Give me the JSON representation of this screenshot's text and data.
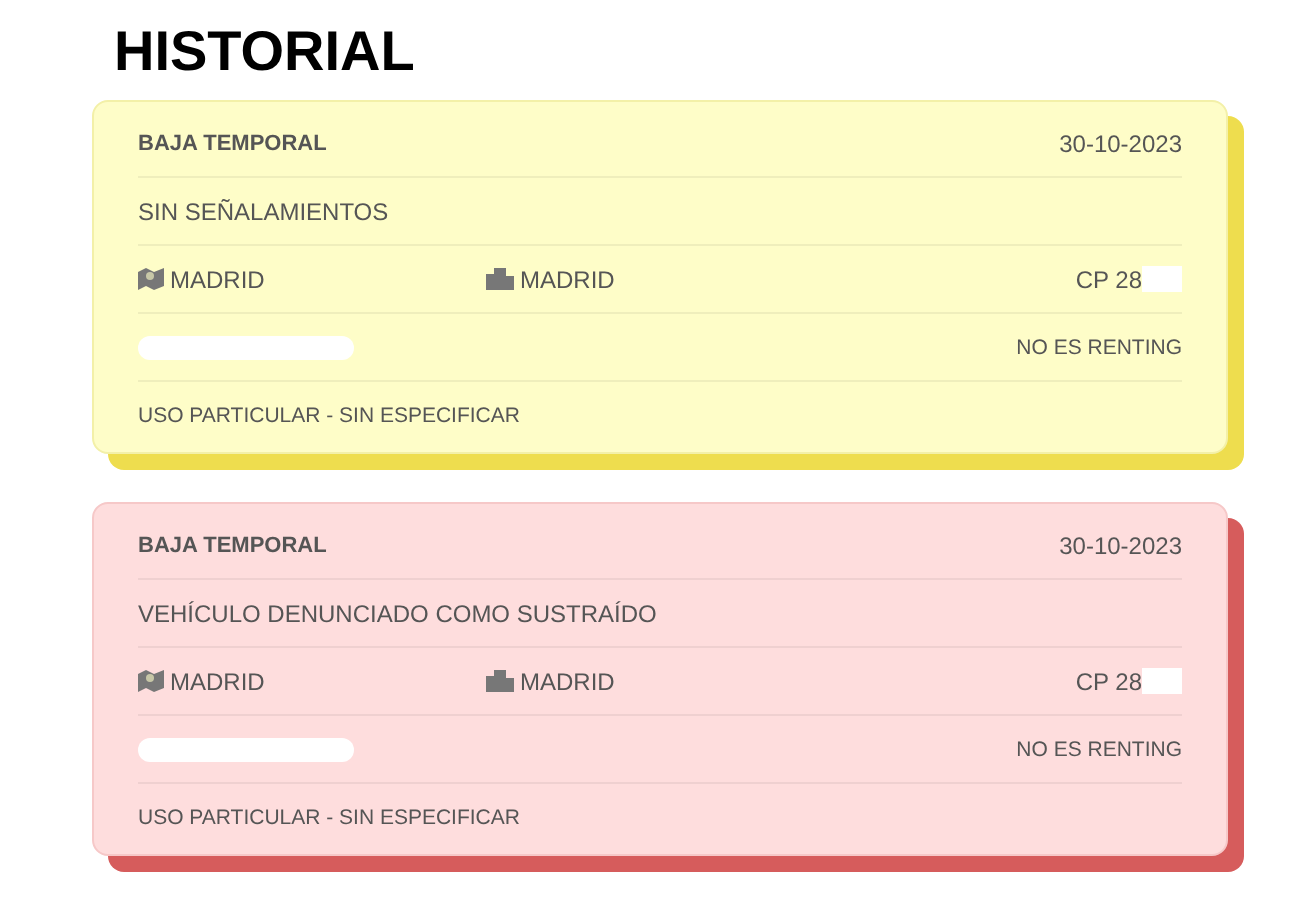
{
  "title": "HISTORIAL",
  "records": [
    {
      "kind": "warning",
      "status": "BAJA TEMPORAL",
      "date": "30-10-2023",
      "description": "SIN SEÑALAMIENTOS",
      "province": "MADRID",
      "city": "MADRID",
      "postal_code": "CP 28",
      "renting": "NO ES RENTING",
      "usage": "USO PARTICULAR - SIN ESPECIFICAR"
    },
    {
      "kind": "alert",
      "status": "BAJA TEMPORAL",
      "date": "30-10-2023",
      "description": "VEHÍCULO DENUNCIADO COMO SUSTRAÍDO",
      "province": "MADRID",
      "city": "MADRID",
      "postal_code": "CP 28",
      "renting": "NO ES RENTING",
      "usage": "USO PARTICULAR - SIN ESPECIFICAR"
    }
  ]
}
